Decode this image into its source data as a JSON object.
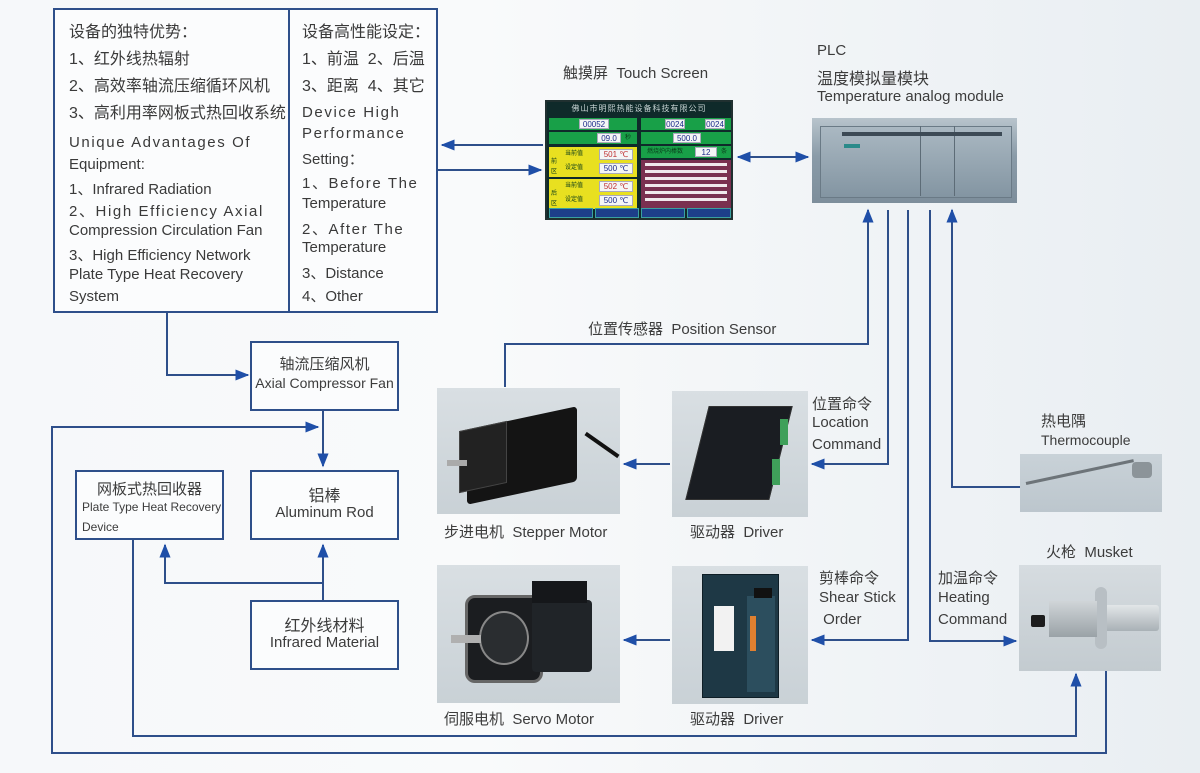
{
  "advantages": {
    "title_cn": "设备的独特优势：",
    "items_cn": [
      "1、红外线热辐射",
      "2、高效率轴流压缩循环风机",
      "3、高利用率网板式热回收系统"
    ],
    "title_en_1": "Unique Advantages Of",
    "title_en_2": "Equipment:",
    "items_en": [
      "1、Infrared Radiation",
      "2、High Efficiency Axial",
      "Compression Circulation Fan",
      "3、High Efficiency Network",
      "Plate Type Heat Recovery",
      "System"
    ]
  },
  "settings": {
    "title_cn": "设备高性能设定：",
    "items_cn": [
      "1、前温  2、后温",
      "3、距离  4、其它"
    ],
    "title_en": [
      "Device High",
      "Performance",
      "Setting："
    ],
    "items_en": [
      "1、Before The",
      "Temperature",
      "2、After The",
      "Temperature",
      "3、Distance",
      "4、Other"
    ]
  },
  "touch_screen": {
    "label": "触摸屏  Touch Screen",
    "header": "佛山市明熙热能设备科技有限公司",
    "count_value": "00052",
    "left_top_value": "0024",
    "right_top_value": "0024",
    "time_value": "09.0",
    "time_unit": "秒",
    "length_value": "500.0",
    "furnace_label": "燃烧炉内棒数",
    "furnace_value": "12",
    "furnace_unit": "条",
    "zone_front": "前区",
    "zone_rear": "后区",
    "current_label": "当前值",
    "set_label": "设定值",
    "front_current": "501 ℃",
    "front_set": "500 ℃",
    "rear_current": "502 ℃",
    "rear_set": "500 ℃"
  },
  "plc": {
    "line1": "PLC",
    "line2": "温度模拟量模块",
    "line3": "Temperature analog module"
  },
  "fan": {
    "cn": "轴流压缩风机",
    "en": "Axial Compressor Fan"
  },
  "aluminum_rod": {
    "cn": "铝棒",
    "en": "Aluminum Rod"
  },
  "heat_recovery": {
    "cn": "网板式热回收器",
    "en1": "Plate Type Heat Recovery",
    "en2": "Device"
  },
  "infrared_material": {
    "cn": "红外线材料",
    "en": "Infrared Material"
  },
  "position_sensor": "位置传感器  Position Sensor",
  "stepper_motor": "步进电机  Stepper Motor",
  "stepper_driver": "驱动器  Driver",
  "location_command": {
    "cn": "位置命令",
    "en1": "Location",
    "en2": "Command"
  },
  "servo_motor": "伺服电机  Servo Motor",
  "servo_driver": "驱动器  Driver",
  "shear_command": {
    "cn": "剪棒命令",
    "en1": "Shear Stick",
    "en2": " Order"
  },
  "heating_command": {
    "cn": "加温命令",
    "en1": "Heating",
    "en2": "Command"
  },
  "thermocouple": {
    "cn": "热电隅",
    "en": "Thermocouple"
  },
  "musket": "火枪  Musket",
  "colors": {
    "line": "#2e4f8a",
    "arrow": "#1f4fa8"
  }
}
